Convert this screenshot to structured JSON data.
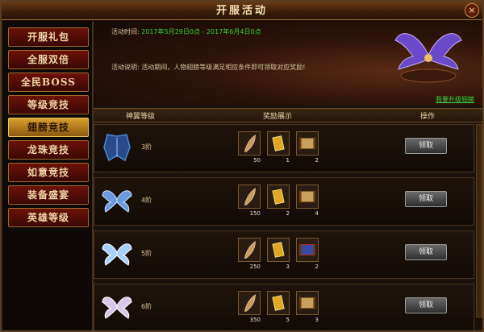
{
  "window": {
    "title": "开服活动",
    "close_label": "×"
  },
  "sidebar": {
    "items": [
      {
        "label": "开服礼包",
        "active": false
      },
      {
        "label": "全服双倍",
        "active": false
      },
      {
        "label": "全民BOSS",
        "active": false
      },
      {
        "label": "等级竞技",
        "active": false
      },
      {
        "label": "翅膀竞技",
        "active": true
      },
      {
        "label": "龙珠竞技",
        "active": false
      },
      {
        "label": "如意竞技",
        "active": false
      },
      {
        "label": "装备盛宴",
        "active": false
      },
      {
        "label": "英雄等级",
        "active": false
      }
    ]
  },
  "banner": {
    "time_label": "活动时间:",
    "time_value": "2017年5月29日0点 - 2017年6月4日0点",
    "desc_label": "活动说明:",
    "desc_value": "活动期间，人物翅膀等级满足相应条件即可领取对应奖励!",
    "link": "我要升级翅膀"
  },
  "table": {
    "headers": [
      "神翼等级",
      "奖励展示",
      "操作"
    ],
    "rows": [
      {
        "tier": "3阶",
        "wing_color": "#4a8ad8",
        "rewards": [
          {
            "icon": "feather-icon",
            "count": "50"
          },
          {
            "icon": "gold-box-icon",
            "count": "1"
          },
          {
            "icon": "scroll-icon",
            "count": "2"
          }
        ],
        "button": "领取"
      },
      {
        "tier": "4阶",
        "wing_color": "#8ab8f0",
        "rewards": [
          {
            "icon": "feather-icon",
            "count": "150"
          },
          {
            "icon": "gold-box-icon",
            "count": "2"
          },
          {
            "icon": "scroll-icon",
            "count": "4"
          }
        ],
        "button": "领取"
      },
      {
        "tier": "5阶",
        "wing_color": "#c8e4ff",
        "rewards": [
          {
            "icon": "feather-icon",
            "count": "250"
          },
          {
            "icon": "gold-box-icon",
            "count": "3"
          },
          {
            "icon": "blue-scroll-icon",
            "count": "2"
          }
        ],
        "button": "领取"
      },
      {
        "tier": "6阶",
        "wing_color": "#e8d8f0",
        "rewards": [
          {
            "icon": "feather-icon",
            "count": "350"
          },
          {
            "icon": "gold-box-icon",
            "count": "5"
          },
          {
            "icon": "scroll-icon",
            "count": "3"
          }
        ],
        "button": "领取"
      }
    ]
  }
}
